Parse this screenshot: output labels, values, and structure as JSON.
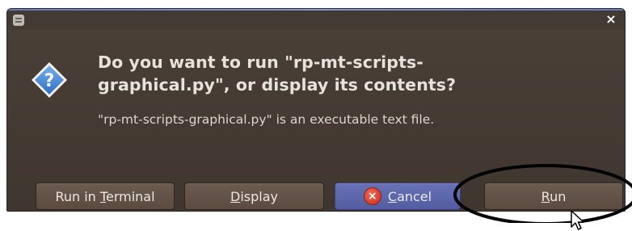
{
  "dialog": {
    "heading_line1": "Do you want to run \"rp-mt-scripts-",
    "heading_line2": "graphical.py\", or display its contents?",
    "subtext": "\"rp-mt-scripts-graphical.py\" is an executable text file.",
    "close_glyph": "×",
    "question_glyph": "?"
  },
  "buttons": {
    "run_in_terminal": {
      "before": "Run in ",
      "mnemonic": "T",
      "after": "erminal"
    },
    "display": {
      "before": "",
      "mnemonic": "D",
      "after": "isplay"
    },
    "cancel": {
      "before": "",
      "mnemonic": "C",
      "after": "ancel",
      "badge": "×"
    },
    "run": {
      "before": "",
      "mnemonic": "R",
      "after": "un"
    }
  },
  "colors": {
    "window_bg": "#4a3f37",
    "heading_text": "#e7e2da",
    "button_bg": "#6c5b50",
    "focused_button_bg": "#6872b6",
    "question_icon_blue": "#3f7fd0",
    "cancel_badge_red": "#d23a27",
    "annotation_ring": "#000000"
  },
  "icons": {
    "app_menu": "window-menu-icon",
    "close": "close-icon",
    "dialog": "question-icon",
    "cancel": "cancel-x-icon",
    "pointer": "mouse-pointer-icon"
  }
}
